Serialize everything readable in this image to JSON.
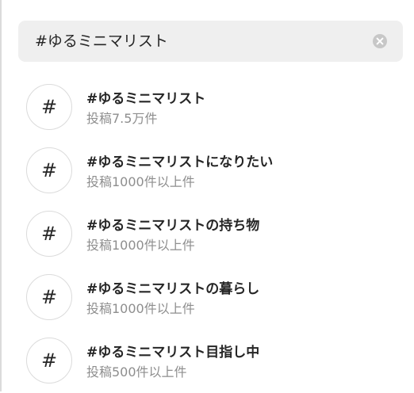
{
  "search": {
    "query": "#ゆるミニマリスト",
    "clear_icon": "clear-circle-icon"
  },
  "results": [
    {
      "icon": "#",
      "title": "#ゆるミニマリスト",
      "posts": "投稿7.5万件"
    },
    {
      "icon": "#",
      "title": "#ゆるミニマリストになりたい",
      "posts": "投稿1000件以上件"
    },
    {
      "icon": "#",
      "title": "#ゆるミニマリストの持ち物",
      "posts": "投稿1000件以上件"
    },
    {
      "icon": "#",
      "title": "#ゆるミニマリストの暮らし",
      "posts": "投稿1000件以上件"
    },
    {
      "icon": "#",
      "title": "#ゆるミニマリスト目指し中",
      "posts": "投稿500件以上件"
    }
  ],
  "colors": {
    "search_bg": "#efefef",
    "primary_text": "#262626",
    "secondary_text": "#8e8e8e",
    "border": "#dbdbdb",
    "clear_icon": "#c7c7c7"
  }
}
